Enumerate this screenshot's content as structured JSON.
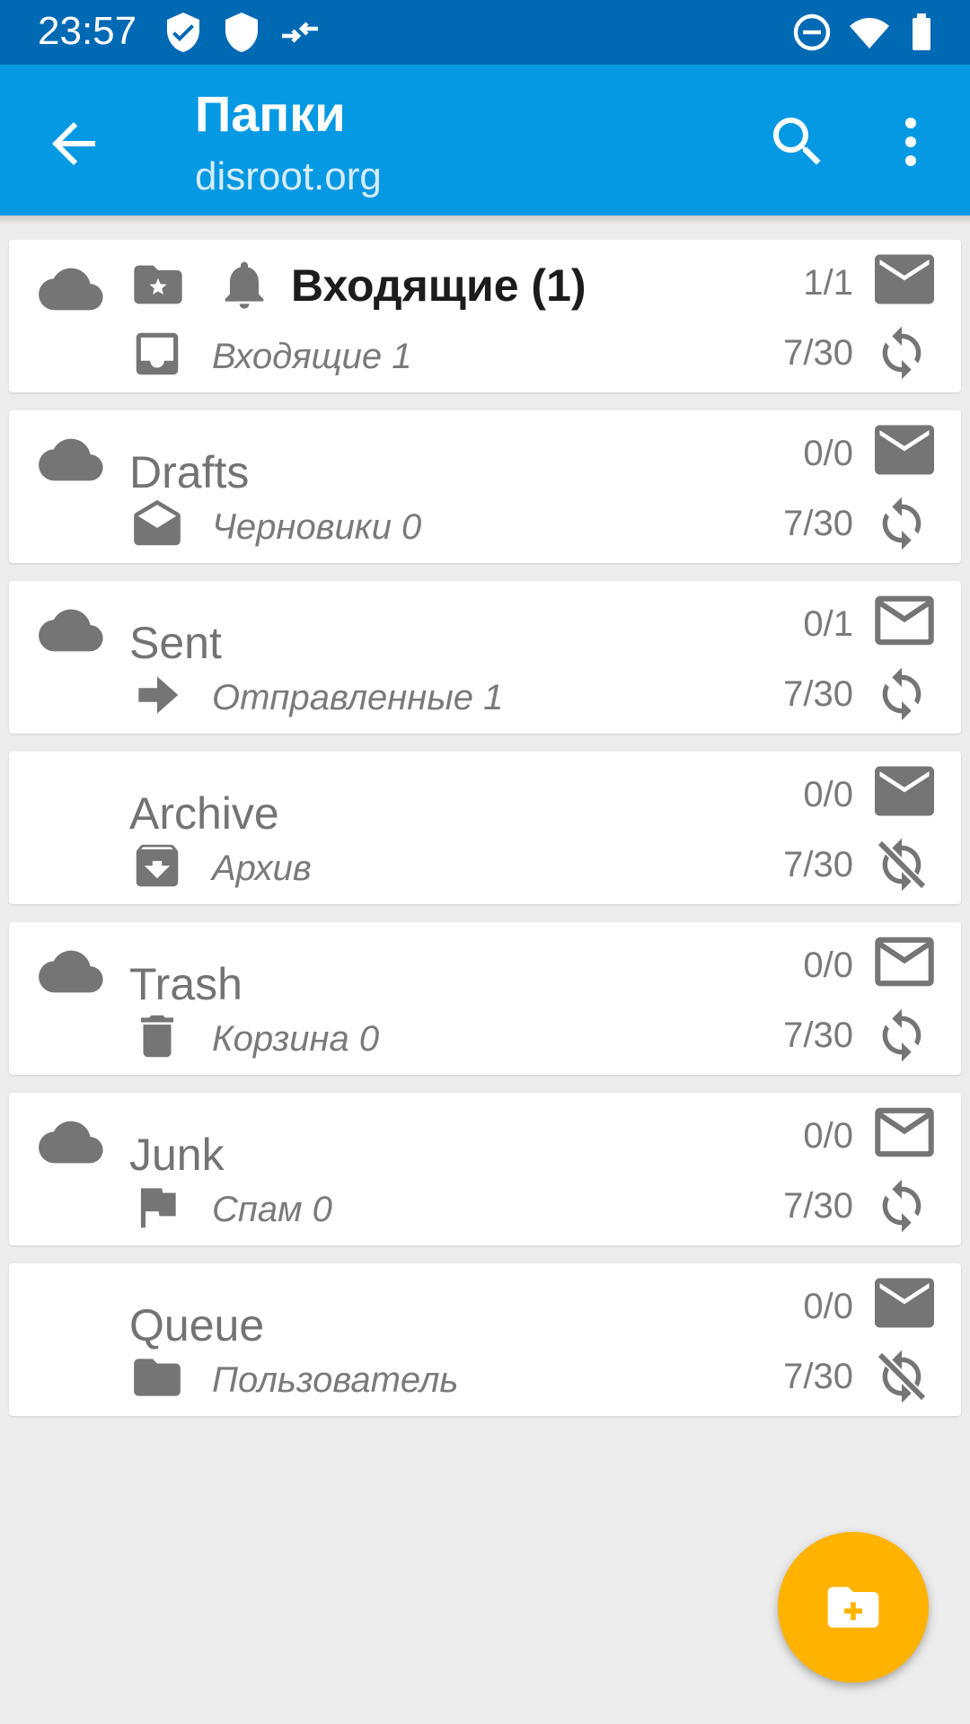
{
  "status_bar": {
    "time": "23:57",
    "icons": [
      "shield-check-icon",
      "shield-icon",
      "data-transfer-icon",
      "do-not-disturb-icon",
      "wifi-icon",
      "battery-icon"
    ]
  },
  "app_bar": {
    "title": "Папки",
    "subtitle": "disroot.org",
    "back_icon": "arrow-back-icon",
    "search_icon": "search-icon",
    "more_icon": "more-vert-icon"
  },
  "folders": [
    {
      "name": "Входящие (1)",
      "bold": true,
      "count_top": "1/1",
      "sub_name": "Входящие  1",
      "count_bottom": "7/30",
      "type_icon": "inbox-icon",
      "cloud": true,
      "notify": true,
      "mail": "filled",
      "sync": "on"
    },
    {
      "name": "Drafts",
      "bold": false,
      "count_top": "0/0",
      "sub_name": "Черновики  0",
      "count_bottom": "7/30",
      "type_icon": "drafts-icon",
      "cloud": true,
      "notify": false,
      "mail": "filled",
      "sync": "on"
    },
    {
      "name": "Sent",
      "bold": false,
      "count_top": "0/1",
      "sub_name": "Отправленные  1",
      "count_bottom": "7/30",
      "type_icon": "send-icon",
      "cloud": true,
      "notify": false,
      "mail": "outline",
      "sync": "on"
    },
    {
      "name": "Archive",
      "bold": false,
      "count_top": "0/0",
      "sub_name": "Архив",
      "count_bottom": "7/30",
      "type_icon": "archive-icon",
      "cloud": false,
      "notify": false,
      "mail": "filled",
      "sync": "off"
    },
    {
      "name": "Trash",
      "bold": false,
      "count_top": "0/0",
      "sub_name": "Корзина  0",
      "count_bottom": "7/30",
      "type_icon": "trash-icon",
      "cloud": true,
      "notify": false,
      "mail": "outline",
      "sync": "on"
    },
    {
      "name": "Junk",
      "bold": false,
      "count_top": "0/0",
      "sub_name": "Спам  0",
      "count_bottom": "7/30",
      "type_icon": "flag-icon",
      "cloud": true,
      "notify": false,
      "mail": "outline",
      "sync": "on"
    },
    {
      "name": "Queue",
      "bold": false,
      "count_top": "0/0",
      "sub_name": "Пользователь",
      "count_bottom": "7/30",
      "type_icon": "folder-icon",
      "cloud": false,
      "notify": false,
      "mail": "filled",
      "sync": "off"
    }
  ],
  "fab": {
    "icon": "create-folder-icon"
  },
  "colors": {
    "status_bar": "#0069b4",
    "app_bar": "#0599e3",
    "fab": "#ffb300",
    "icon_gray": "#757575",
    "background": "#ececec"
  }
}
